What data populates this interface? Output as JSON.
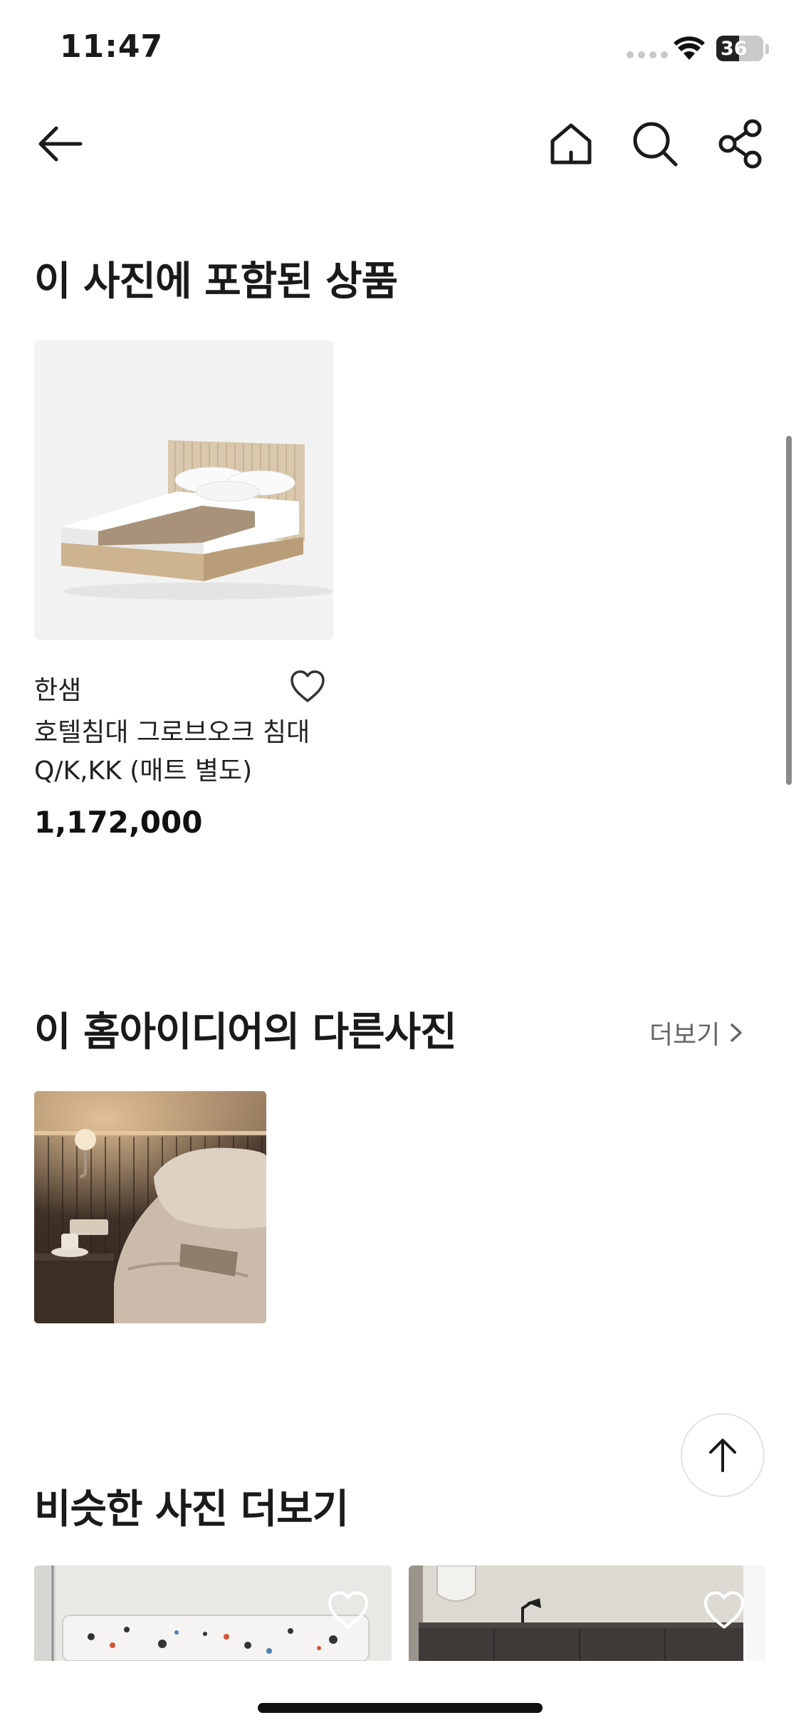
{
  "status_bar": {
    "time": "11:47",
    "battery": "36"
  },
  "nav": {
    "back_icon": "arrow-left-icon",
    "home_icon": "home-icon",
    "search_icon": "search-icon",
    "share_icon": "share-icon"
  },
  "products_section": {
    "title": "이 사진에 포함된 상품",
    "product": {
      "brand": "한샘",
      "name": "호텔침대 그로브오크 침대 Q/K,KK (매트 별도)",
      "price": "1,172,000"
    }
  },
  "other_photos_section": {
    "title": "이 홈아이디어의 다른사진",
    "more_label": "더보기"
  },
  "similar_section": {
    "title": "비슷한 사진 더보기"
  }
}
